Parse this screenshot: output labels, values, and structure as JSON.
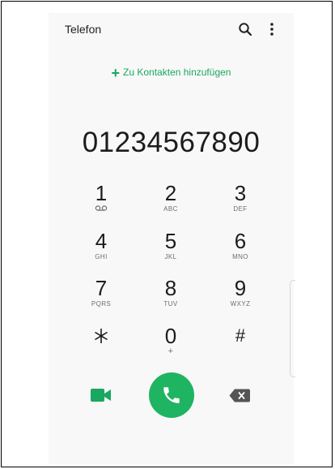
{
  "header": {
    "title": "Telefon"
  },
  "add_contact": {
    "plus": "+",
    "label": "Zu Kontakten hinzufügen"
  },
  "display": {
    "number": "01234567890"
  },
  "keypad": [
    {
      "digit": "1",
      "letters": "voicemail-icon"
    },
    {
      "digit": "2",
      "letters": "ABC"
    },
    {
      "digit": "3",
      "letters": "DEF"
    },
    {
      "digit": "4",
      "letters": "GHI"
    },
    {
      "digit": "5",
      "letters": "JKL"
    },
    {
      "digit": "6",
      "letters": "MNO"
    },
    {
      "digit": "7",
      "letters": "PQRS"
    },
    {
      "digit": "8",
      "letters": "TUV"
    },
    {
      "digit": "9",
      "letters": "WXYZ"
    },
    {
      "digit": "*",
      "letters": ""
    },
    {
      "digit": "0",
      "letters": "+"
    },
    {
      "digit": "#",
      "letters": ""
    }
  ],
  "colors": {
    "accent": "#1aa760",
    "call_button": "#1fb461",
    "text": "#1c1c1c",
    "subtext": "#6e6e6e"
  },
  "icons": [
    "search-icon",
    "more-vert-icon",
    "voicemail-icon",
    "video-call-icon",
    "phone-icon",
    "backspace-icon"
  ]
}
